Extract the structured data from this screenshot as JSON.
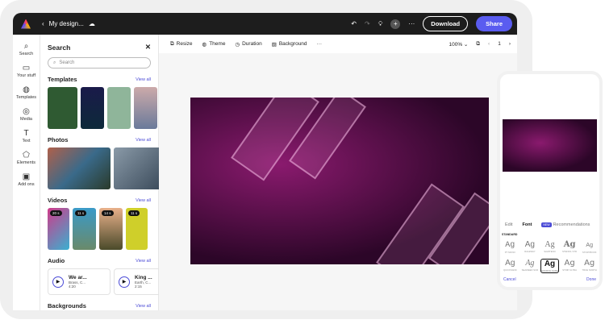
{
  "topbar": {
    "title": "My design...",
    "download": "Download",
    "share": "Share"
  },
  "rail": [
    {
      "icon": "⌕",
      "label": "Search"
    },
    {
      "icon": "▭",
      "label": "Your stuff"
    },
    {
      "icon": "◍",
      "label": "Templates"
    },
    {
      "icon": "◎",
      "label": "Media"
    },
    {
      "icon": "T",
      "label": "Text"
    },
    {
      "icon": "⬠",
      "label": "Elements"
    },
    {
      "icon": "▣",
      "label": "Add ons"
    }
  ],
  "panel": {
    "title": "Search",
    "search_placeholder": "Search",
    "view_all": "View all",
    "sections": {
      "templates": "Templates",
      "photos": "Photos",
      "videos": "Videos",
      "audio": "Audio",
      "backgrounds": "Backgrounds"
    },
    "videos": [
      "20 s",
      "11 s",
      "14 s",
      "11 s"
    ],
    "audio": [
      {
        "title": "We ar...",
        "artist": "Brass, C...",
        "duration": "4:20"
      },
      {
        "title": "King ...",
        "artist": "Earth, C...",
        "duration": "2:15"
      }
    ]
  },
  "toolbar": {
    "resize": "Resize",
    "theme": "Theme",
    "duration": "Duration",
    "background": "Background",
    "zoom": "100%",
    "page": "1"
  },
  "phone": {
    "tabs": {
      "edit": "Edit",
      "font": "Font",
      "new": "NEW",
      "recommendations": "Recommendations"
    },
    "standard": "STANDARD",
    "fonts": [
      {
        "name": "PT MONO"
      },
      {
        "name": "RALEWAY"
      },
      {
        "name": "SAVATENO"
      },
      {
        "name": "STENCIL STD"
      },
      {
        "name": "STORYBOOK"
      },
      {
        "name": "QUICKSAND"
      },
      {
        "name": "SEAWEED SCR"
      },
      {
        "name": "SOURCE SANS"
      },
      {
        "name": "STRIP ULTRA"
      },
      {
        "name": "TRUE NORTH"
      }
    ],
    "sample": "Ag",
    "cancel": "Cancel",
    "done": "Done"
  },
  "colors": {
    "accent": "#5a5cf0"
  }
}
